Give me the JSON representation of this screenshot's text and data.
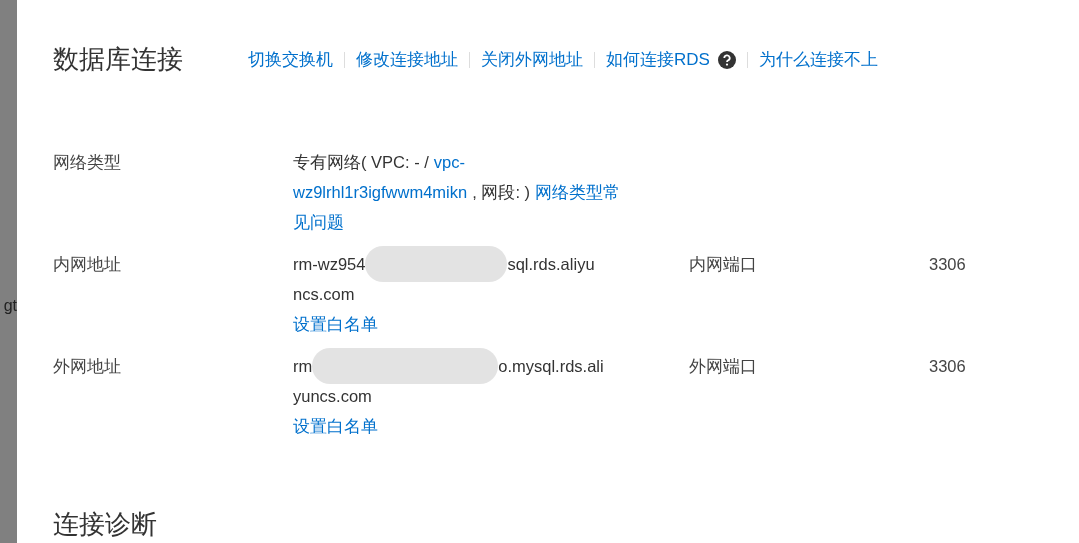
{
  "background_page": {
    "cut_text": "gt"
  },
  "title": "数据库连接",
  "actions": [
    {
      "label": "切换交换机",
      "help": false
    },
    {
      "label": "修改连接地址",
      "help": false
    },
    {
      "label": "关闭外网地址",
      "help": false
    },
    {
      "label": "如何连接RDS",
      "help": true
    },
    {
      "label": "为什么连接不上",
      "help": false
    }
  ],
  "network_type": {
    "label": "网络类型",
    "lines": [
      [
        {
          "kind": "text",
          "text": "专有网络( VPC: - /"
        },
        {
          "kind": "link",
          "text": "vpc-"
        }
      ],
      [
        {
          "kind": "link",
          "text": "wz9lrhl1r3igfwwm4mikn"
        },
        {
          "kind": "text",
          "text": ", 网段: )"
        },
        {
          "kind": "link",
          "text": "网络类型常"
        }
      ],
      [
        {
          "kind": "link",
          "text": "见问题"
        }
      ]
    ]
  },
  "addresses": [
    {
      "label": "内网地址",
      "start": "rm-wz954",
      "end": "sql.rds.aliyu",
      "continued": "ncs.com",
      "whitelist_link": "设置白名单",
      "port_label": "内网端口",
      "port": "3306"
    },
    {
      "label": "外网地址",
      "start": "rm",
      "end": "o.mysql.rds.ali",
      "continued": "yuncs.com",
      "whitelist_link": "设置白名单",
      "port_label": "外网端口",
      "port": "3306"
    }
  ],
  "next_section_title": "连接诊断"
}
